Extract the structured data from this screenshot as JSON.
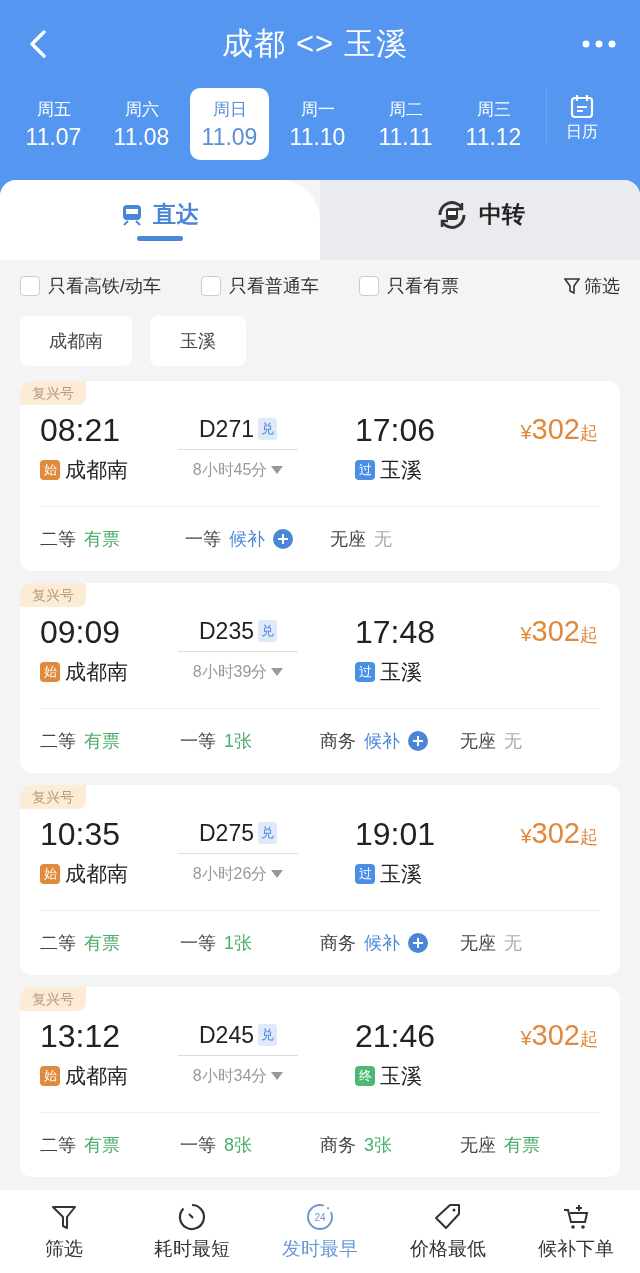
{
  "header": {
    "title": "成都 <> 玉溪"
  },
  "dates": [
    {
      "weekday": "周五",
      "date": "11.07",
      "selected": false
    },
    {
      "weekday": "周六",
      "date": "11.08",
      "selected": false
    },
    {
      "weekday": "周日",
      "date": "11.09",
      "selected": true
    },
    {
      "weekday": "周一",
      "date": "11.10",
      "selected": false
    },
    {
      "weekday": "周二",
      "date": "11.11",
      "selected": false
    },
    {
      "weekday": "周三",
      "date": "11.12",
      "selected": false
    }
  ],
  "calendar": {
    "label": "日历"
  },
  "tabs": [
    {
      "label": "直达",
      "kind": "direct",
      "selected": true
    },
    {
      "label": "中转",
      "kind": "transfer",
      "selected": false
    }
  ],
  "filters": [
    {
      "label": "只看高铁/动车",
      "checked": false
    },
    {
      "label": "只看普通车",
      "checked": false
    },
    {
      "label": "只看有票",
      "checked": false
    }
  ],
  "filter_button": "筛选",
  "stations": [
    "成都南",
    "玉溪"
  ],
  "trains": [
    {
      "tag": "复兴号",
      "depart": "08:21",
      "train_no": "D271",
      "badge": "兑",
      "arrive": "17:06",
      "currency": "¥",
      "price": "302",
      "price_suffix": "起",
      "from": {
        "mark": "始",
        "color": "#e08a3c",
        "name": "成都南"
      },
      "duration": "8小时45分",
      "to": {
        "mark": "过",
        "color": "#4a8ee6",
        "name": "玉溪"
      },
      "seats": [
        {
          "class": "二等",
          "status": "有票",
          "kind": "available"
        },
        {
          "class": "一等",
          "status": "候补",
          "kind": "waitlist"
        },
        {
          "class": "无座",
          "status": "无",
          "kind": "none"
        }
      ]
    },
    {
      "tag": "复兴号",
      "depart": "09:09",
      "train_no": "D235",
      "badge": "兑",
      "arrive": "17:48",
      "currency": "¥",
      "price": "302",
      "price_suffix": "起",
      "from": {
        "mark": "始",
        "color": "#e08a3c",
        "name": "成都南"
      },
      "duration": "8小时39分",
      "to": {
        "mark": "过",
        "color": "#4a8ee6",
        "name": "玉溪"
      },
      "seats": [
        {
          "class": "二等",
          "status": "有票",
          "kind": "available"
        },
        {
          "class": "一等",
          "status": "1张",
          "kind": "available"
        },
        {
          "class": "商务",
          "status": "候补",
          "kind": "waitlist"
        },
        {
          "class": "无座",
          "status": "无",
          "kind": "none"
        }
      ]
    },
    {
      "tag": "复兴号",
      "depart": "10:35",
      "train_no": "D275",
      "badge": "兑",
      "arrive": "19:01",
      "currency": "¥",
      "price": "302",
      "price_suffix": "起",
      "from": {
        "mark": "始",
        "color": "#e08a3c",
        "name": "成都南"
      },
      "duration": "8小时26分",
      "to": {
        "mark": "过",
        "color": "#4a8ee6",
        "name": "玉溪"
      },
      "seats": [
        {
          "class": "二等",
          "status": "有票",
          "kind": "available"
        },
        {
          "class": "一等",
          "status": "1张",
          "kind": "available"
        },
        {
          "class": "商务",
          "status": "候补",
          "kind": "waitlist"
        },
        {
          "class": "无座",
          "status": "无",
          "kind": "none"
        }
      ]
    },
    {
      "tag": "复兴号",
      "depart": "13:12",
      "train_no": "D245",
      "badge": "兑",
      "arrive": "21:46",
      "currency": "¥",
      "price": "302",
      "price_suffix": "起",
      "from": {
        "mark": "始",
        "color": "#e08a3c",
        "name": "成都南"
      },
      "duration": "8小时34分",
      "to": {
        "mark": "终",
        "color": "#4cb872",
        "name": "玉溪"
      },
      "seats": [
        {
          "class": "二等",
          "status": "有票",
          "kind": "available"
        },
        {
          "class": "一等",
          "status": "8张",
          "kind": "available"
        },
        {
          "class": "商务",
          "status": "3张",
          "kind": "available"
        },
        {
          "class": "无座",
          "status": "有票",
          "kind": "available"
        }
      ]
    }
  ],
  "bottom_bar": [
    {
      "label": "筛选",
      "kind": "filter",
      "selected": false
    },
    {
      "label": "耗时最短",
      "kind": "timer",
      "selected": false
    },
    {
      "label": "发时最早",
      "kind": "clock",
      "icon_text": "24",
      "selected": true
    },
    {
      "label": "价格最低",
      "kind": "tag",
      "selected": false
    },
    {
      "label": "候补下单",
      "kind": "cart",
      "selected": false
    }
  ]
}
